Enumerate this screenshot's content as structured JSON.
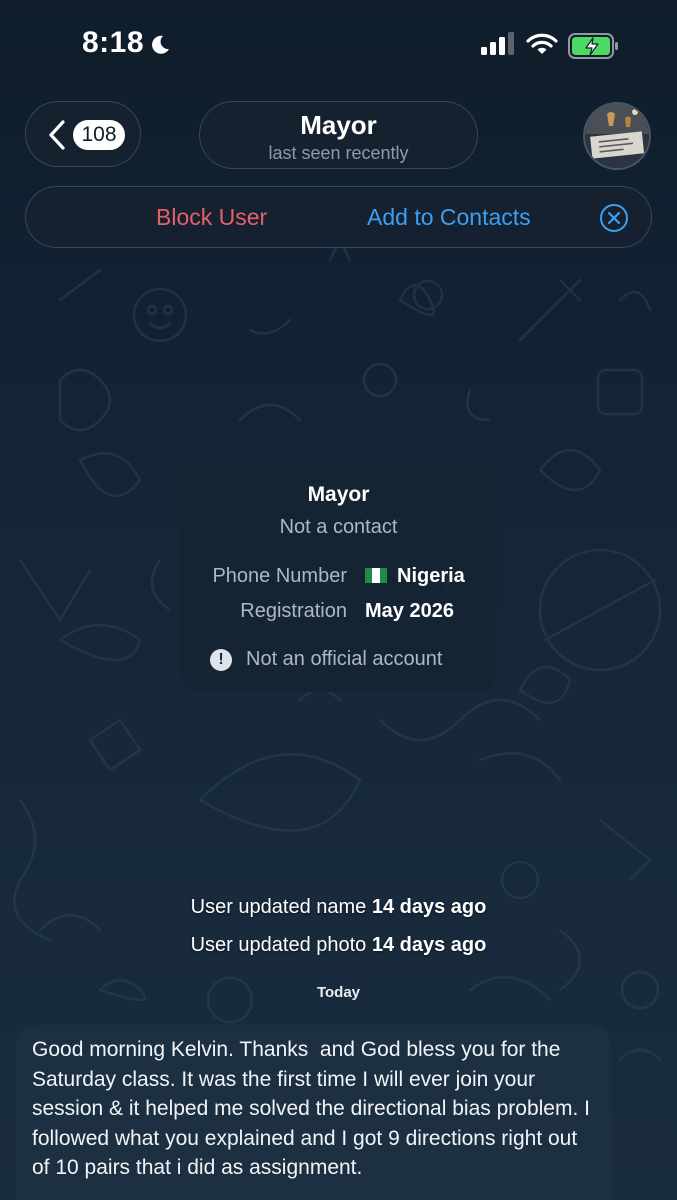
{
  "status_bar": {
    "time": "8:18",
    "icons": [
      "moon-icon",
      "cellular-signal-icon",
      "wifi-icon",
      "battery-charging-icon"
    ]
  },
  "header": {
    "back_badge": "108",
    "title": "Mayor",
    "subtitle": "last seen recently",
    "avatar_icon": "profile-photo"
  },
  "action_bar": {
    "block_label": "Block User",
    "add_label": "Add to Contacts",
    "close_icon": "close-circle-icon",
    "colors": {
      "block": "#e5616a",
      "add": "#3e9ff0"
    }
  },
  "info_card": {
    "name": "Mayor",
    "status": "Not a contact",
    "phone_label": "Phone Number",
    "phone_value": "Nigeria",
    "phone_flag_icon": "nigeria-flag-icon",
    "registration_label": "Registration",
    "registration_value": "May 2026",
    "notice_icon": "exclamation-circle-icon",
    "notice": "Not an official account"
  },
  "service_messages": [
    {
      "text": "User updated name",
      "time": "14 days ago"
    },
    {
      "text": "User updated photo",
      "time": "14 days ago"
    }
  ],
  "date_divider": "Today",
  "messages": [
    {
      "text": "Good morning Kelvin. Thanks  and God bless you for the Saturday class. It was the first time I will ever join your session & it helped me solved the directional bias problem. I followed what you explained and I got 9 directions right out of 10 pairs that i did as assignment."
    }
  ]
}
